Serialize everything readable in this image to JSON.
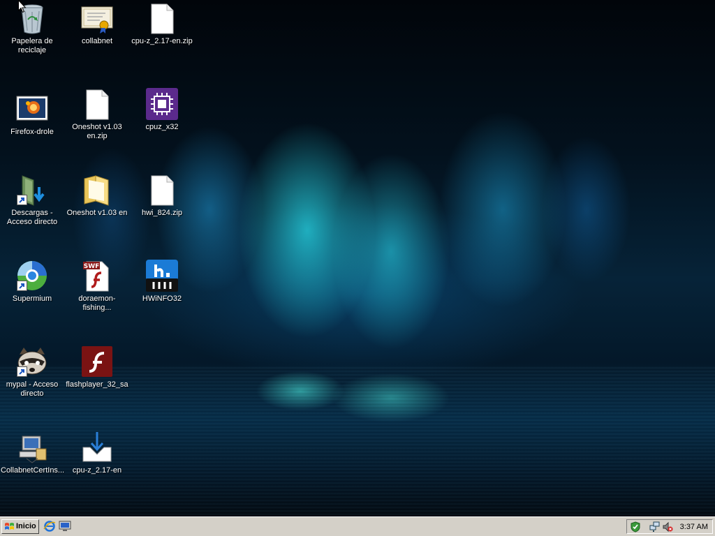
{
  "desktop": {
    "icons": [
      {
        "label": "Papelera de reciclaje",
        "icon": "recycle-bin-icon"
      },
      {
        "label": "collabnet",
        "icon": "certificate-icon"
      },
      {
        "label": "cpu-z_2.17-en.zip",
        "icon": "file-icon"
      },
      {
        "label": "Firefox-drole",
        "icon": "image-file-icon"
      },
      {
        "label": "Oneshot v1.03 en.zip",
        "icon": "file-icon"
      },
      {
        "label": "cpuz_x32",
        "icon": "cpuz-icon"
      },
      {
        "label": "Descargas - Acceso directo",
        "icon": "downloads-folder-icon"
      },
      {
        "label": "Oneshot v1.03 en",
        "icon": "folder-icon"
      },
      {
        "label": "hwi_824.zip",
        "icon": "file-icon"
      },
      {
        "label": "Supermium",
        "icon": "supermium-browser-icon"
      },
      {
        "label": "doraemon-fishing...",
        "icon": "swf-file-icon"
      },
      {
        "label": "HWiNFO32",
        "icon": "hwinfo-icon"
      },
      {
        "label": "mypal - Acceso directo",
        "icon": "mypal-browser-icon"
      },
      {
        "label": "flashplayer_32_sa",
        "icon": "flash-player-icon"
      },
      {
        "label": "CollabnetCertIns...",
        "icon": "installer-icon"
      },
      {
        "label": "cpu-z_2.17-en",
        "icon": "download-icon"
      }
    ]
  },
  "taskbar": {
    "start_label": "Inicio",
    "quick_launch": [
      "internet-explorer-icon",
      "show-desktop-icon"
    ],
    "tray_icons": [
      "security-shield-icon",
      "network-icon",
      "volume-muted-icon"
    ],
    "clock": "3:37 AM"
  }
}
